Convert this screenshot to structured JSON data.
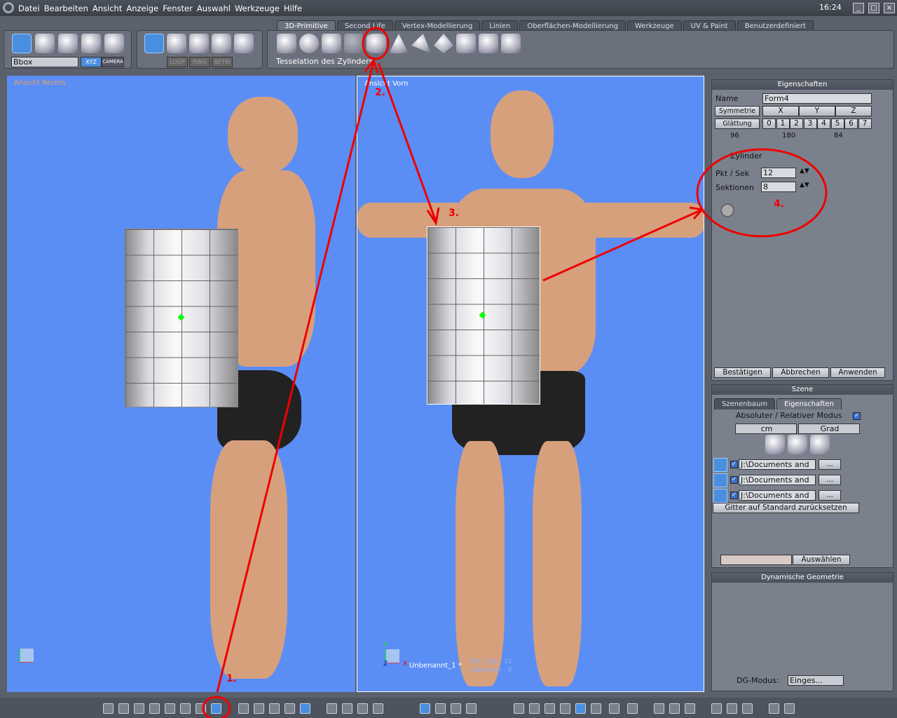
{
  "menu": [
    "Datei",
    "Bearbeiten",
    "Ansicht",
    "Anzeige",
    "Fenster",
    "Auswahl",
    "Werkzeuge",
    "Hilfe"
  ],
  "clock": "16:24",
  "window_buttons": [
    "_",
    "□",
    "×"
  ],
  "toolbar": {
    "bbox_select": "Bbox",
    "xyz": "XYZ",
    "camera": "CAMERA",
    "loop": "LOOP",
    "ring": "RING",
    "betw": "BETW"
  },
  "tabs": [
    "3D-Primitive",
    "Second Life",
    "Vertex-Modellierung",
    "Linien",
    "Oberflächen-Modellierung",
    "Werkzeuge",
    "UV & Paint",
    "Benutzerdefiniert"
  ],
  "tooltip": "Tesselation des Zylinders",
  "viewports": {
    "left_label": "Ansicht Rechts",
    "right_label": "Ansicht Vorn",
    "scene_name": "Unbenannt_1 *",
    "overlay_line1": "Pkt / Sek : 12",
    "overlay_line2": "Sektionen : 8",
    "axis_x": "X",
    "axis_y": "Y",
    "axis_z": "Z"
  },
  "properties": {
    "title": "Eigenschaften",
    "name_label": "Name",
    "name_value": "Form4",
    "symmetry": "Symmetrie",
    "sym_axes": [
      "X",
      "Y",
      "Z"
    ],
    "smoothing": "Glättung",
    "smooth_levels": [
      "0",
      "1",
      "2",
      "3",
      "4",
      "5",
      "6",
      "7"
    ],
    "counts": [
      "96",
      "180",
      "84"
    ],
    "object_type": "Zylinder",
    "pkt_label": "Pkt / Sek",
    "pkt_value": "12",
    "sek_label": "Sektionen",
    "sek_value": "8",
    "confirm": "Bestätigen",
    "cancel": "Abbrechen",
    "apply": "Anwenden"
  },
  "scene": {
    "title": "Szene",
    "tabs": [
      "Szenenbaum",
      "Eigenschaften"
    ],
    "mode_label": "Absoluter / Relativer Modus",
    "unit": "cm",
    "angle": "Grad",
    "grids": [
      "J:\\Documents and",
      "J:\\Documents and",
      "J:\\Documents and"
    ],
    "more": "...",
    "reset": "Gitter auf Standard zurücksetzen",
    "select": "Auswählen"
  },
  "dyngeo": {
    "title": "Dynamische Geometrie",
    "mode_label": "DG-Modus:",
    "mode_value": "Einges..."
  },
  "annotations": [
    "1.",
    "2.",
    "3.",
    "4."
  ],
  "colors": {
    "viewport": "#5b8ef5",
    "annotation": "#e00000",
    "accent": "#4a8ee0"
  }
}
